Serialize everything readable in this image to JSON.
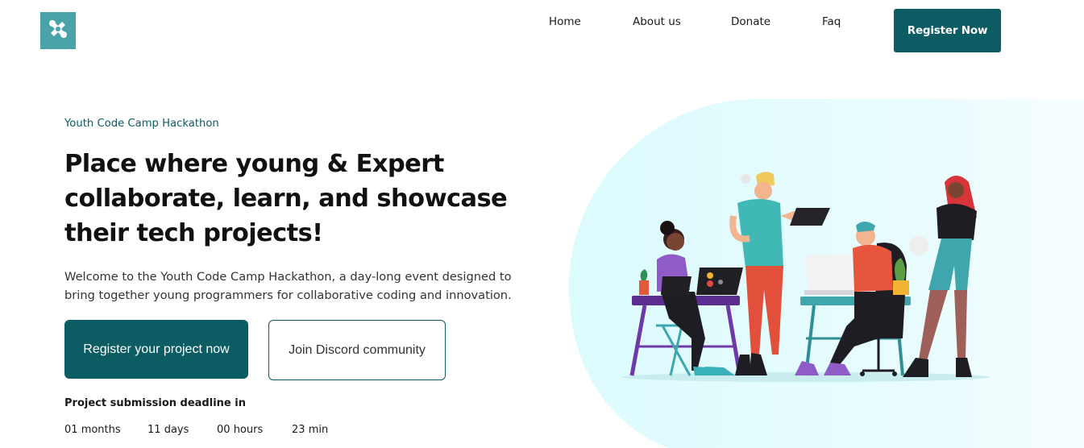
{
  "nav": {
    "logo_icon": "tools-icon",
    "links": [
      {
        "label": "Home"
      },
      {
        "label": "About us"
      },
      {
        "label": "Donate"
      },
      {
        "label": "Faq"
      }
    ],
    "cta_label": "Register Now"
  },
  "hero": {
    "eyebrow": "Youth Code Camp Hackathon",
    "headline": "Place where young & Expert collaborate, learn, and showcase their tech projects!",
    "intro": "Welcome to the Youth Code Camp Hackathon, a day-long event designed to bring together young programmers for collaborative coding and innovation.",
    "primary_button": "Register your project now",
    "secondary_button": "Join Discord community",
    "deadline_label": "Project submission deadline in",
    "countdown": [
      {
        "value": "01",
        "unit": "months"
      },
      {
        "value": "11",
        "unit": "days"
      },
      {
        "value": "00",
        "unit": "hours"
      },
      {
        "value": "23",
        "unit": "min"
      }
    ]
  },
  "colors": {
    "brand": "#0c5c63",
    "logo_bg": "#4aa3a8",
    "hero_blob": "#e3fbfd"
  }
}
